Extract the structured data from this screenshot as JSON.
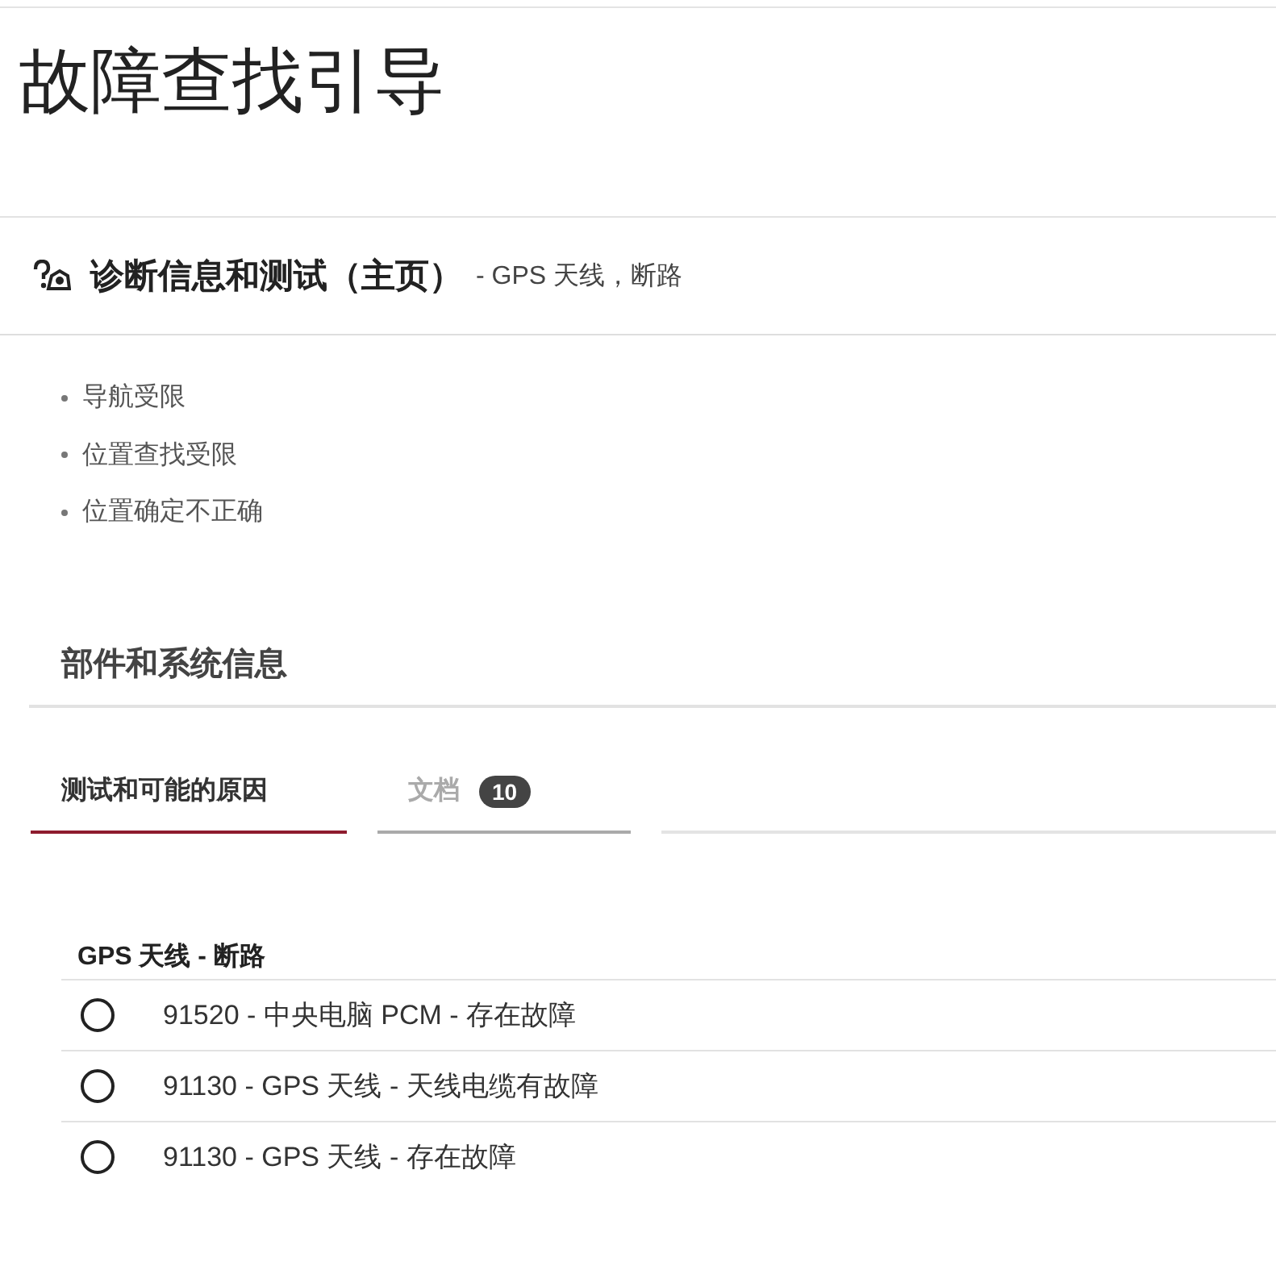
{
  "page_title": "故障查找引导",
  "header": {
    "title": "诊断信息和测试（主页）",
    "subtitle": "- GPS 天线，断路"
  },
  "symptoms": [
    "导航受限",
    "位置查找受限",
    "位置确定不正确"
  ],
  "section_title": "部件和系统信息",
  "tabs": [
    {
      "label": "测试和可能的原因",
      "selected": true
    },
    {
      "label": "文档",
      "badge": "10",
      "selected": false
    }
  ],
  "group": {
    "title": "GPS 天线 - 断路",
    "options": [
      {
        "label": "91520 - 中央电脑 PCM - 存在故障",
        "selected": false
      },
      {
        "label": "91130 - GPS 天线 - 天线电缆有故障",
        "selected": false
      },
      {
        "label": "91130 - GPS 天线 - 存在故障",
        "selected": false
      }
    ]
  }
}
